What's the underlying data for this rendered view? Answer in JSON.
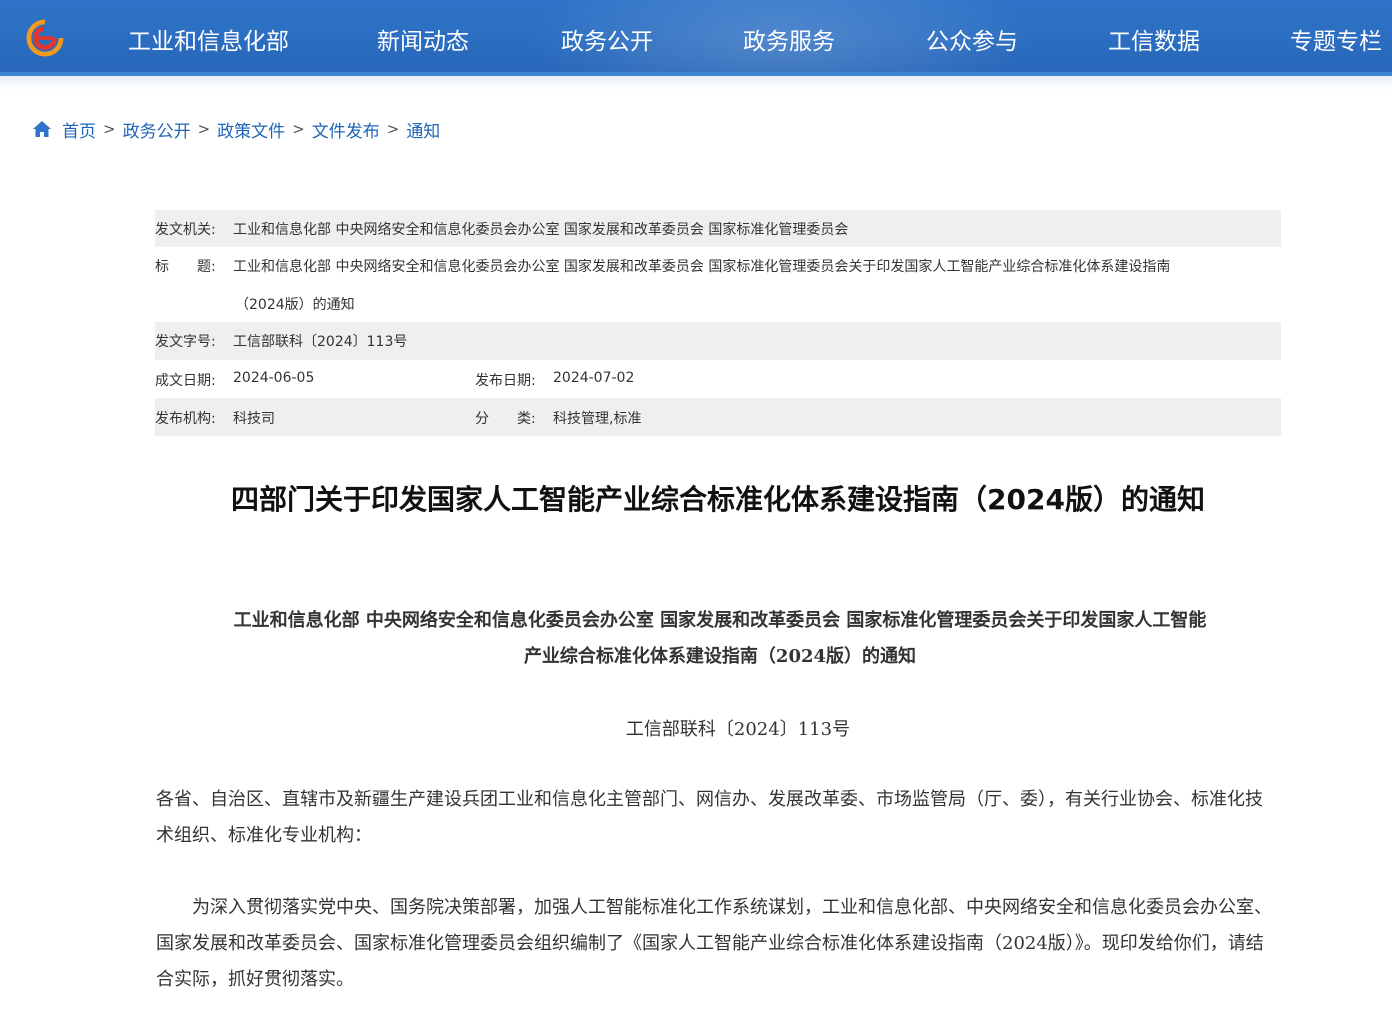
{
  "nav": {
    "items": [
      "工业和信息化部",
      "新闻动态",
      "政务公开",
      "政务服务",
      "公众参与",
      "工信数据",
      "专题专栏"
    ]
  },
  "breadcrumb": {
    "items": [
      "首页",
      "政务公开",
      "政策文件",
      "文件发布",
      "通知"
    ],
    "separator": ">"
  },
  "meta": {
    "issuer_label": "发文机关:",
    "issuer_value": "工业和信息化部 中央网络安全和信息化委员会办公室 国家发展和改革委员会 国家标准化管理委员会",
    "title_label": "标　　题:",
    "title_value_line1": "工业和信息化部 中央网络安全和信息化委员会办公室 国家发展和改革委员会 国家标准化管理委员会关于印发国家人工智能产业综合标准化体系建设指南",
    "title_value_line2": "（2024版）的通知",
    "docno_label": "发文字号:",
    "docno_value": "工信部联科〔2024〕113号",
    "written_label": "成文日期:",
    "written_value": "2024-06-05",
    "published_label": "发布日期:",
    "published_value": "2024-07-02",
    "org_label": "发布机构:",
    "org_value": "科技司",
    "category_label": "分　　类:",
    "category_value": "科技管理,标准"
  },
  "article": {
    "title": "四部门关于印发国家人工智能产业综合标准化体系建设指南（2024版）的通知",
    "heading_line1": "工业和信息化部 中央网络安全和信息化委员会办公室 国家发展和改革委员会 国家标准化管理委员会关于印发国家人工智能",
    "heading_line2": "产业综合标准化体系建设指南（2024版）的通知",
    "doc_number": "工信部联科〔2024〕113号",
    "salutation": "各省、自治区、直辖市及新疆生产建设兵团工业和信息化主管部门、网信办、发展改革委、市场监管局（厅、委），有关行业协会、标准化技术组织、标准化专业机构：",
    "body": "为深入贯彻落实党中央、国务院决策部署，加强人工智能标准化工作系统谋划，工业和信息化部、中央网络安全和信息化委员会办公室、国家发展和改革委员会、国家标准化管理委员会组织编制了《国家人工智能产业综合标准化体系建设指南（2024版）》。现印发给你们，请结合实际，抓好贯彻落实。"
  },
  "colors": {
    "header_blue": "#2b6ec2",
    "link_blue": "#1f64b8",
    "meta_shade": "#efefef"
  }
}
